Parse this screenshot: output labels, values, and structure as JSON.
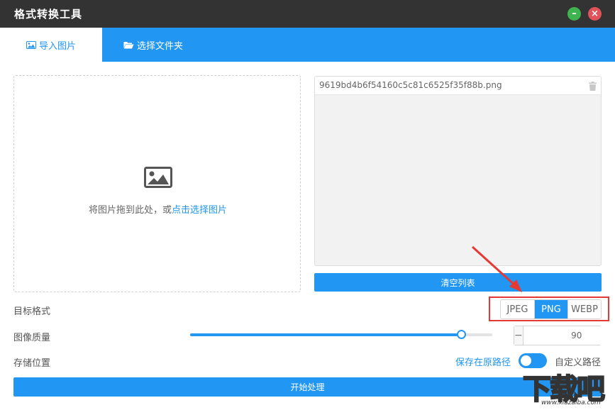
{
  "window": {
    "title": "格式转换工具",
    "minimize_icon": "minus-icon",
    "close_icon": "close-icon"
  },
  "tabs": [
    {
      "label": "导入图片",
      "icon": "image-icon",
      "active": true
    },
    {
      "label": "选择文件夹",
      "icon": "folder-open-icon",
      "active": false
    }
  ],
  "dropzone": {
    "icon": "picture-icon",
    "hint_prefix": "将图片拖到此处，或",
    "hint_link": "点击选择图片"
  },
  "file_list": {
    "items": [
      {
        "name": "9619bd4b6f54160c5c81c6525f35f88b.png",
        "icon": "trash-icon"
      }
    ]
  },
  "clear_button": {
    "label": "清空列表"
  },
  "target_format": {
    "label": "目标格式",
    "options": [
      "JPEG",
      "PNG",
      "WEBP"
    ],
    "selected": "PNG"
  },
  "quality": {
    "label": "图像质量",
    "value": 90,
    "min": 0,
    "max": 100,
    "minus": "−",
    "plus": "+"
  },
  "save_location": {
    "label": "存储位置",
    "option_original": "保存在原路径",
    "option_custom": "自定义路径",
    "toggle_on": false
  },
  "start_button": {
    "label": "开始处理"
  },
  "watermark": {
    "text": "下载吧",
    "url": "www.xiazaiba.com"
  },
  "colors": {
    "accent": "#2196f3",
    "titlebar": "#333333",
    "minimize": "#3fb34f",
    "close": "#e0535a",
    "highlight": "#e53935"
  }
}
